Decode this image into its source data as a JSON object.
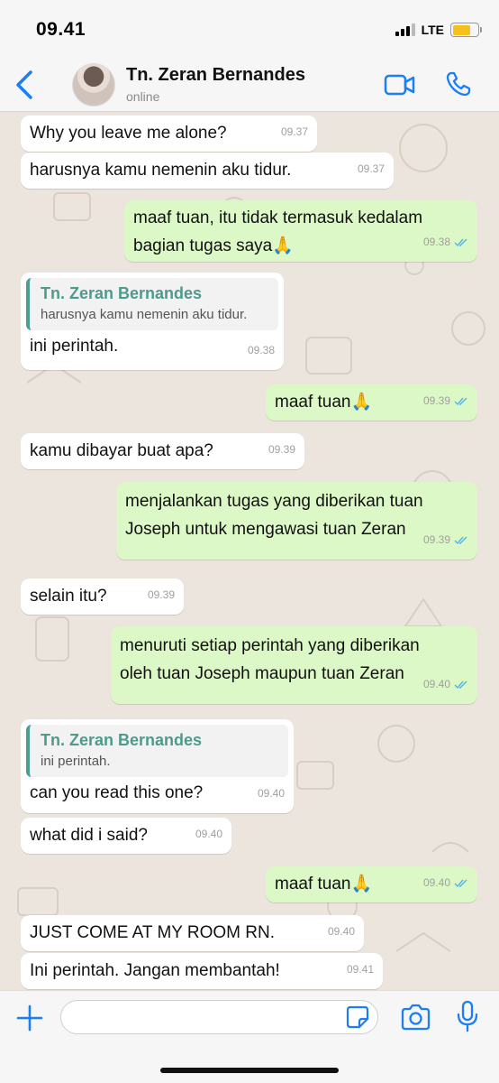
{
  "status_bar": {
    "time": "09.41",
    "network": "LTE"
  },
  "header": {
    "contact_name": "Tn. Zeran Bernandes",
    "status": "online"
  },
  "colors": {
    "accent": "#1b7ef6",
    "outgoing_bubble": "#dcf8c6",
    "incoming_bubble": "#ffffff",
    "quote_bar": "#4a9e8f",
    "read_ticks": "#4fb3f0"
  },
  "messages": [
    {
      "text": "Why you leave me alone?",
      "time": "09.37"
    },
    {
      "text": "harusnya kamu nemenin aku tidur.",
      "time": "09.37"
    },
    {
      "text_line1": "maaf tuan, itu tidak termasuk kedalam",
      "text_line2": "bagian tugas saya",
      "emoji": "🙏",
      "time": "09.38"
    },
    {
      "quote_name": "Tn. Zeran Bernandes",
      "quote_text": "harusnya kamu nemenin aku tidur.",
      "text": "ini perintah.",
      "time": "09.38"
    },
    {
      "text": "maaf tuan",
      "emoji": "🙏",
      "time": "09.39"
    },
    {
      "text": "kamu dibayar buat apa?",
      "time": "09.39"
    },
    {
      "text_line1": "menjalankan tugas yang diberikan tuan",
      "text_line2": "Joseph untuk mengawasi tuan Zeran",
      "time": "09.39"
    },
    {
      "text": "selain itu?",
      "time": "09.39"
    },
    {
      "text_line1": "menuruti setiap perintah yang diberikan",
      "text_line2": "oleh tuan Joseph maupun tuan Zeran",
      "time": "09.40"
    },
    {
      "quote_name": "Tn. Zeran Bernandes",
      "quote_text": "ini perintah.",
      "text": "can you read this one?",
      "time": "09.40"
    },
    {
      "text": "what did i said?",
      "time": "09.40"
    },
    {
      "text": "maaf tuan",
      "emoji": "🙏",
      "time": "09.40"
    },
    {
      "text": "JUST COME AT MY ROOM RN.",
      "time": "09.40"
    },
    {
      "text": "Ini perintah. Jangan membantah!",
      "time": "09.41"
    }
  ],
  "composer": {
    "value": "",
    "placeholder": ""
  }
}
